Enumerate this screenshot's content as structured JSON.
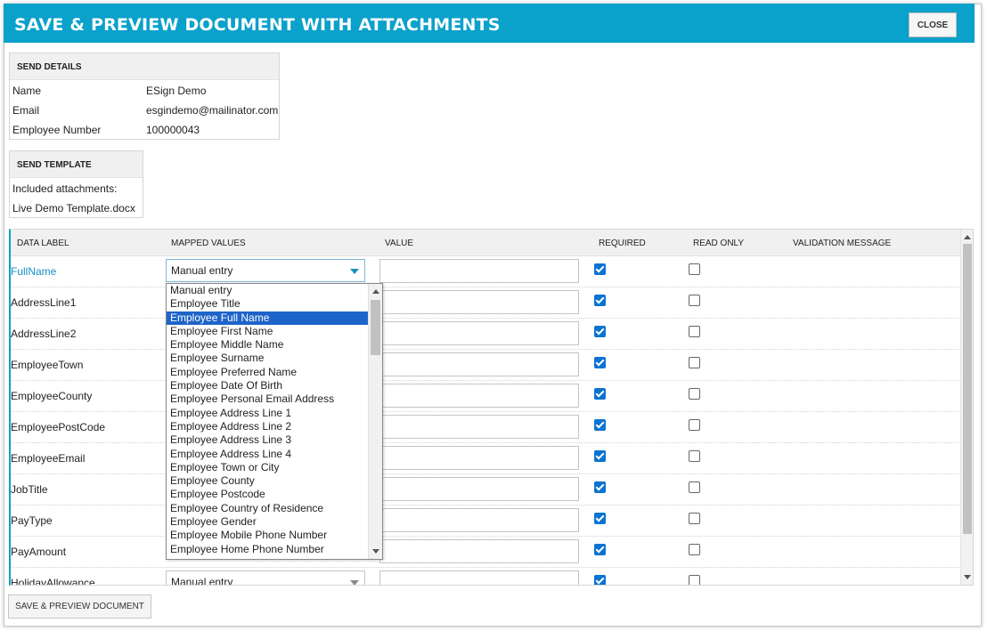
{
  "dialog": {
    "title": "SAVE & PREVIEW DOCUMENT WITH ATTACHMENTS",
    "close_label": "CLOSE",
    "title_bar_color": "#0aa1cb"
  },
  "send_details": {
    "header": "SEND DETAILS",
    "rows": [
      {
        "key": "Name",
        "value": "ESign Demo"
      },
      {
        "key": "Email",
        "value": "esgindemo@mailinator.com"
      },
      {
        "key": "Employee Number",
        "value": "100000043"
      }
    ]
  },
  "send_template": {
    "header": "SEND TEMPLATE",
    "attachments_label": "Included attachments:",
    "file_name": "Live Demo Template.docx"
  },
  "grid": {
    "columns": {
      "data_label": "DATA LABEL",
      "mapped_values": "MAPPED VALUES",
      "value": "VALUE",
      "required": "REQUIRED",
      "read_only": "READ ONLY",
      "validation_message": "VALIDATION MESSAGE"
    },
    "rows": [
      {
        "label": "FullName",
        "mapped": "Manual entry",
        "required": true,
        "read_only": false
      },
      {
        "label": "AddressLine1",
        "mapped": "",
        "required": true,
        "read_only": false
      },
      {
        "label": "AddressLine2",
        "mapped": "",
        "required": true,
        "read_only": false
      },
      {
        "label": "EmployeeTown",
        "mapped": "",
        "required": true,
        "read_only": false
      },
      {
        "label": "EmployeeCounty",
        "mapped": "",
        "required": true,
        "read_only": false
      },
      {
        "label": "EmployeePostCode",
        "mapped": "",
        "required": true,
        "read_only": false
      },
      {
        "label": "EmployeeEmail",
        "mapped": "",
        "required": true,
        "read_only": false
      },
      {
        "label": "JobTitle",
        "mapped": "",
        "required": true,
        "read_only": false
      },
      {
        "label": "PayType",
        "mapped": "",
        "required": true,
        "read_only": false
      },
      {
        "label": "PayAmount",
        "mapped": "",
        "required": true,
        "read_only": false
      },
      {
        "label": "HolidayAllowance",
        "mapped": "Manual entry",
        "required": true,
        "read_only": false
      }
    ]
  },
  "dropdown": {
    "selected": "Employee Full Name",
    "options": [
      "Manual entry",
      "Employee Title",
      "Employee Full Name",
      "Employee First Name",
      "Employee Middle Name",
      "Employee Surname",
      "Employee Preferred Name",
      "Employee Date Of Birth",
      "Employee Personal Email Address",
      "Employee Address Line 1",
      "Employee Address Line 2",
      "Employee Address Line 3",
      "Employee Address Line 4",
      "Employee Town or City",
      "Employee County",
      "Employee Postcode",
      "Employee Country of Residence",
      "Employee Gender",
      "Employee Mobile Phone Number",
      "Employee Home Phone Number"
    ]
  },
  "footer": {
    "save_preview_label": "SAVE & PREVIEW DOCUMENT"
  }
}
